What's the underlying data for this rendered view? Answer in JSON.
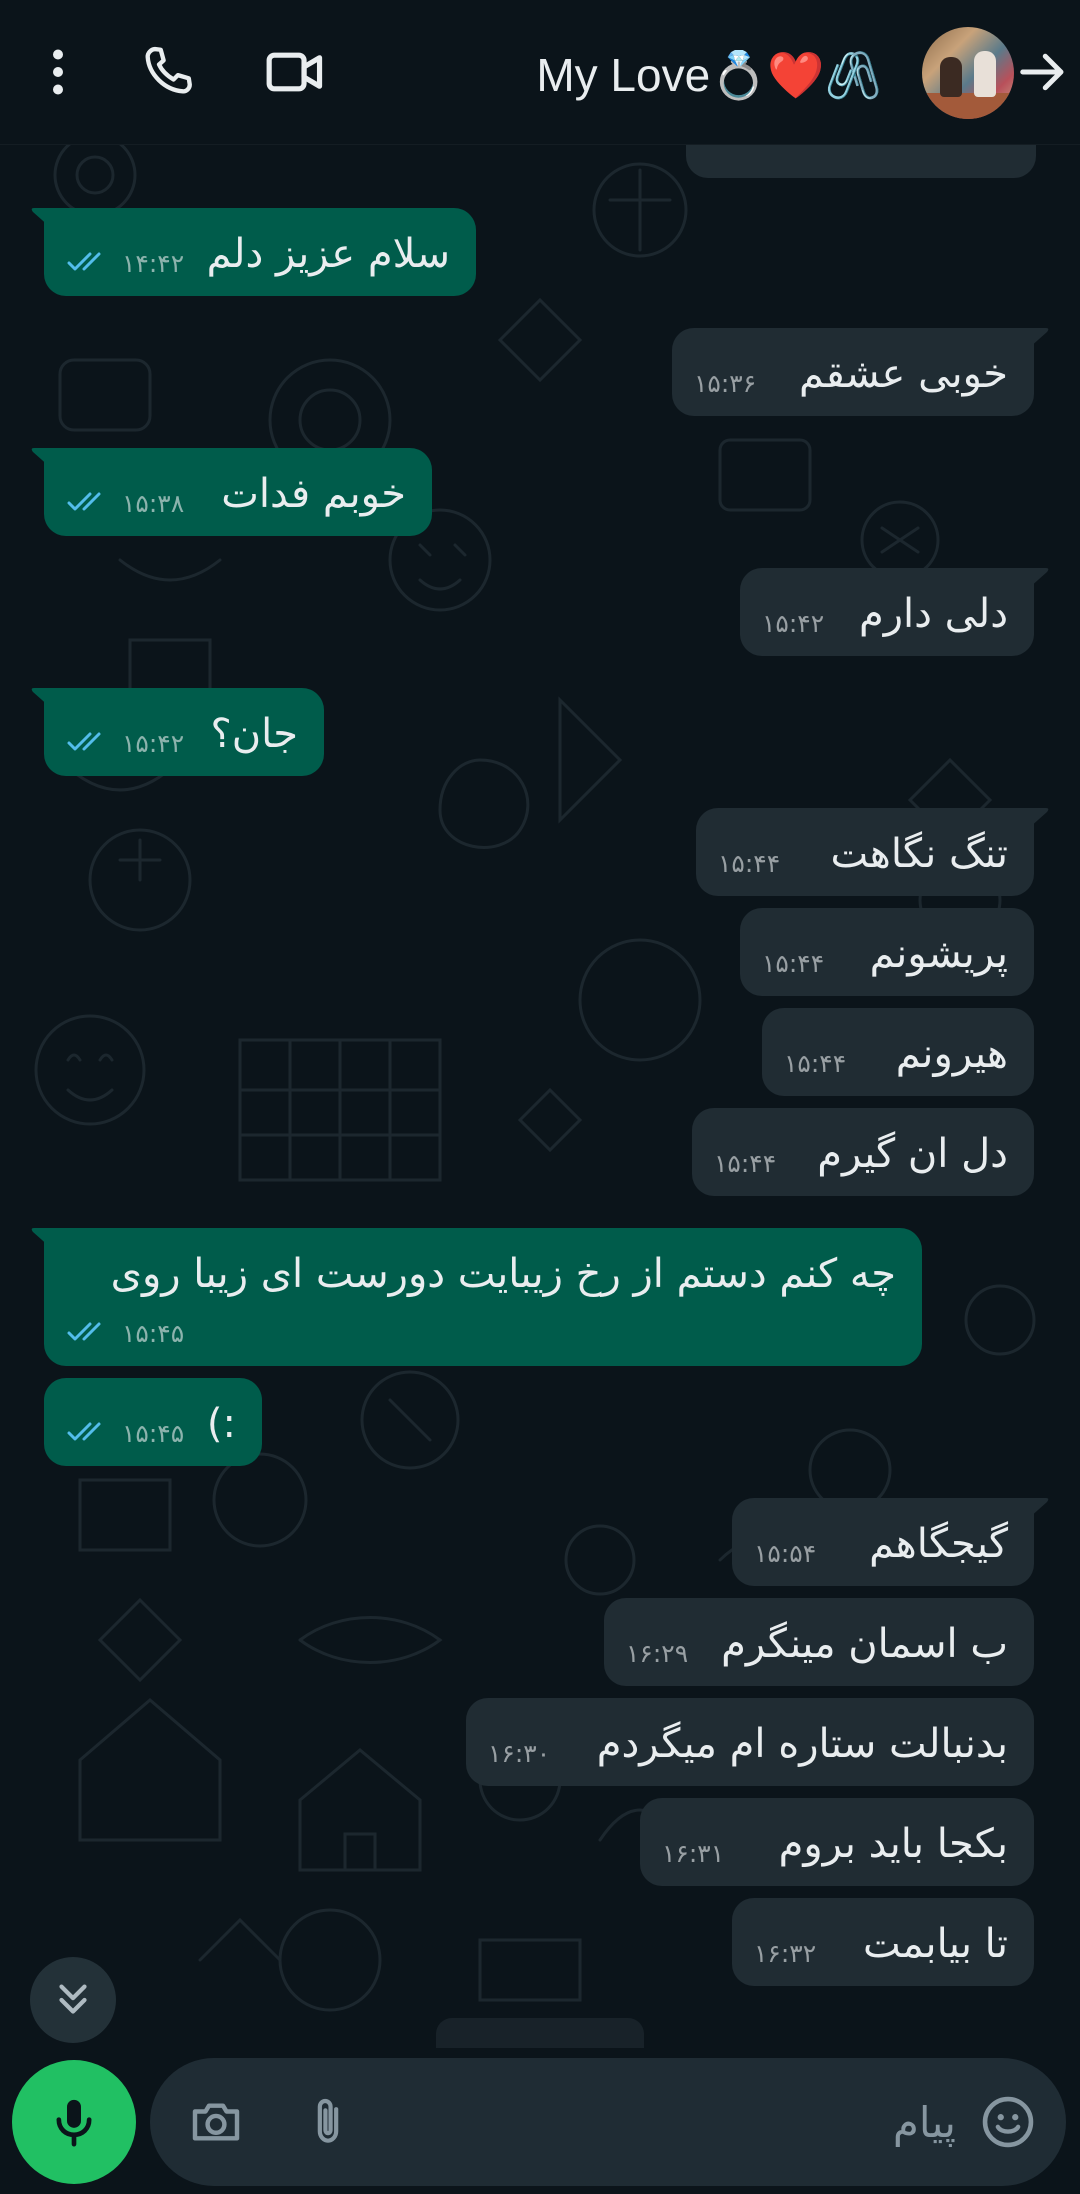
{
  "header": {
    "contact_name": "My Love💍❤️🖇️",
    "icons": [
      "more-vert-icon",
      "phone-icon",
      "video-camera-icon",
      "back-arrow-icon"
    ]
  },
  "messages": [
    {
      "dir": "out",
      "text": "سلام عزیز دلم",
      "time": "۱۴:۴۲",
      "status": "read"
    },
    {
      "dir": "in",
      "text": "خوبی عشقم",
      "time": "۱۵:۳۶"
    },
    {
      "dir": "out",
      "text": "خوبم فدات",
      "time": "۱۵:۳۸",
      "status": "read"
    },
    {
      "dir": "in",
      "text": "دلی دارم",
      "time": "۱۵:۴۲"
    },
    {
      "dir": "out",
      "text": "جان؟",
      "time": "۱۵:۴۲",
      "status": "read"
    },
    {
      "dir": "in",
      "text": "تنگ نگاهت",
      "time": "۱۵:۴۴"
    },
    {
      "dir": "in",
      "text": "پریشونم",
      "time": "۱۵:۴۴"
    },
    {
      "dir": "in",
      "text": "هیرونم",
      "time": "۱۵:۴۴"
    },
    {
      "dir": "in",
      "text": "دل ان گیرم",
      "time": "۱۵:۴۴"
    },
    {
      "dir": "out",
      "text": "چه کنم دستم از رخ زیبایت دورست ای زیبا روی",
      "time": "۱۵:۴۵",
      "status": "read"
    },
    {
      "dir": "out",
      "text": ":)",
      "time": "۱۵:۴۵",
      "status": "read"
    },
    {
      "dir": "in",
      "text": "گیجگاهم",
      "time": "۱۵:۵۴"
    },
    {
      "dir": "in",
      "text": "ب اسمان مینگرم",
      "time": "۱۶:۲۹"
    },
    {
      "dir": "in",
      "text": "بدنبالت ستاره ام میگردم",
      "time": "۱۶:۳۰"
    },
    {
      "dir": "in",
      "text": "بکجا باید بروم",
      "time": "۱۶:۳۱"
    },
    {
      "dir": "in",
      "text": "تا بیابمت",
      "time": "۱۶:۳۲"
    }
  ],
  "colors": {
    "background": "#0b141a",
    "outgoing_bubble": "#005c4b",
    "incoming_bubble": "#202c33",
    "read_ticks": "#53bdeb",
    "mic_button": "#21c063",
    "composer": "#1f2c34"
  },
  "composer": {
    "placeholder": "پیام",
    "icons": [
      "camera-icon",
      "paperclip-icon",
      "emoji-icon",
      "microphone-icon"
    ]
  },
  "scroll_button_icon": "double-chevron-down-icon"
}
